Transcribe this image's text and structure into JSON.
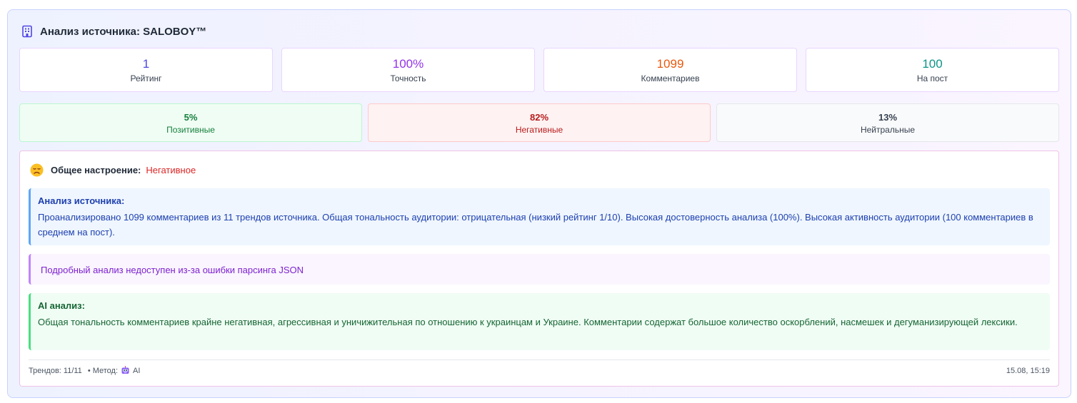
{
  "header": {
    "title": "Анализ источника: SALOBOY™",
    "icon": "building-icon"
  },
  "stats": [
    {
      "value": "1",
      "label": "Рейтинг",
      "color": "#4f46e5"
    },
    {
      "value": "100%",
      "label": "Точность",
      "color": "#9333ea"
    },
    {
      "value": "1099",
      "label": "Комментариев",
      "color": "#ea580c"
    },
    {
      "value": "100",
      "label": "На пост",
      "color": "#0d9488"
    }
  ],
  "sentiment": {
    "positive": {
      "pct": "5%",
      "label": "Позитивные"
    },
    "negative": {
      "pct": "82%",
      "label": "Негативные"
    },
    "neutral": {
      "pct": "13%",
      "label": "Нейтральные"
    }
  },
  "mood": {
    "label": "Общее настроение:",
    "value": "Негативное",
    "icon": "sad-face-icon"
  },
  "source_analysis": {
    "title": "Анализ источника:",
    "text": "Проанализировано 1099 комментариев из 11 трендов источника. Общая тональность аудитории: отрицательная (низкий рейтинг 1/10). Высокая достоверность анализа (100%). Высокая активность аудитории (100 комментариев в среднем на пост)."
  },
  "error_notice": {
    "text": "Подробный анализ недоступен из-за ошибки парсинга JSON"
  },
  "ai_analysis": {
    "title": "AI анализ:",
    "text": "Общая тональность комментариев крайне негативная, агрессивная и уничижительная по отношению к украинцам и Украине. Комментарии содержат большое количество оскорблений, насмешек и дегуманизирующей лексики."
  },
  "footer": {
    "trends": "Трендов: 11/11",
    "method_label": "• Метод:",
    "method_value": "AI",
    "timestamp": "15.08, 15:19"
  }
}
